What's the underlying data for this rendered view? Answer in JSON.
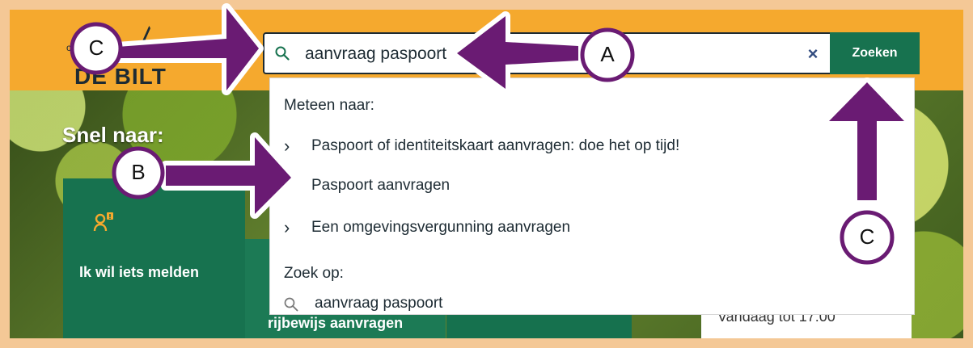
{
  "site": {
    "logo_text": "DE BILT",
    "logo_small": "c"
  },
  "search": {
    "value": "aanvraag paspoort",
    "clear_icon": "close-icon",
    "button_label": "Zoeken"
  },
  "dropdown": {
    "meteen_heading": "Meteen naar:",
    "items": [
      {
        "label": "Paspoort of identiteitskaart aanvragen: doe het op tijd!",
        "icon": "chevron-right-icon"
      },
      {
        "label": "Paspoort aanvragen"
      },
      {
        "label": "Een omgevingsvergunning aanvragen",
        "icon": "chevron-right-icon"
      }
    ],
    "zoek_heading": "Zoek op:",
    "search_suggestion": "aanvraag paspoort"
  },
  "page": {
    "snel_naar": "Snel naar:",
    "card_melden": "Ik wil iets melden",
    "card_rijbewijs": "rijbewijs aanvragen",
    "vandaag": "Vandaag tot 17:00"
  },
  "callouts": {
    "a": "A",
    "b": "B",
    "c_left": "C",
    "c_right": "C"
  },
  "colors": {
    "accent_orange": "#f5a92e",
    "brand_green": "#17724f",
    "callout_purple": "#6a1b73",
    "outline": "#1d2b33"
  }
}
